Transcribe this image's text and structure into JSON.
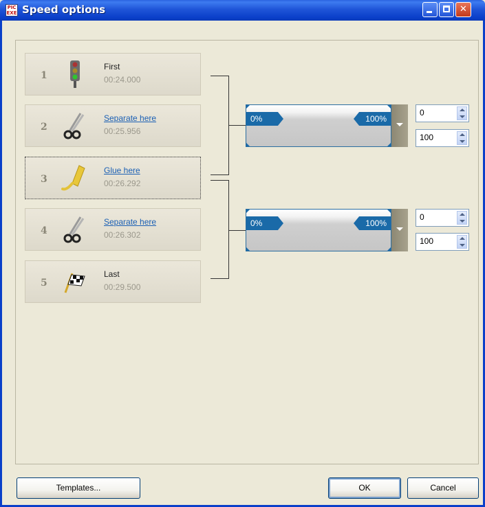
{
  "window": {
    "title": "Speed options",
    "app_icon_text": "PIC EXE"
  },
  "slides": [
    {
      "number": "1",
      "name": "First",
      "time": "00:24.000",
      "icon": "traffic-light-icon",
      "link": false
    },
    {
      "number": "2",
      "name": "Separate here",
      "time": "00:25.956",
      "icon": "scissors-icon",
      "link": true
    },
    {
      "number": "3",
      "name": "Glue here",
      "time": "00:26.292",
      "icon": "glue-tube-icon",
      "link": true
    },
    {
      "number": "4",
      "name": "Separate here",
      "time": "00:26.302",
      "icon": "scissors-icon",
      "link": true
    },
    {
      "number": "5",
      "name": "Last",
      "time": "00:29.500",
      "icon": "checkered-flag-icon",
      "link": false
    }
  ],
  "segments": [
    {
      "start_label": "0%",
      "end_label": "100%",
      "start_value": "0",
      "end_value": "100"
    },
    {
      "start_label": "0%",
      "end_label": "100%",
      "start_value": "0",
      "end_value": "100"
    }
  ],
  "buttons": {
    "templates": "Templates...",
    "ok": "OK",
    "cancel": "Cancel"
  },
  "colors": {
    "titlebar": "#0a3fc9",
    "speed_label": "#1a6aa8",
    "link": "#1a5fb4"
  }
}
